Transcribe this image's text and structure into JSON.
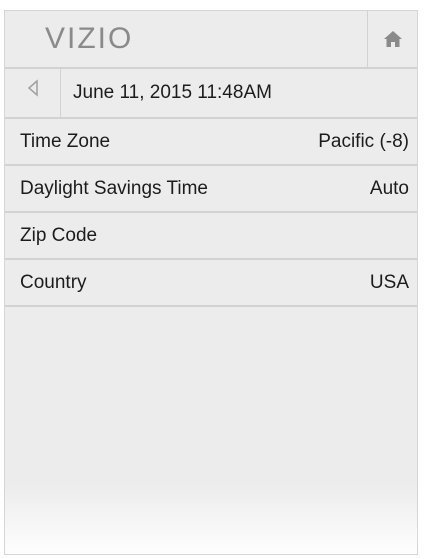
{
  "header": {
    "logo": "VIZIO",
    "home_icon": "home-icon"
  },
  "date_row": {
    "back_icon": "back-triangle-icon",
    "datetime": "June 11, 2015 11:48AM"
  },
  "settings": [
    {
      "label": "Time Zone",
      "value": "Pacific (-8)"
    },
    {
      "label": "Daylight Savings Time",
      "value": "Auto"
    },
    {
      "label": "Zip Code",
      "value": ""
    },
    {
      "label": "Country",
      "value": "USA"
    }
  ],
  "colors": {
    "panel_bg": "#ececec",
    "divider": "#d2d2d2",
    "logo": "#8a8a8a",
    "text": "#1c1c1c"
  }
}
